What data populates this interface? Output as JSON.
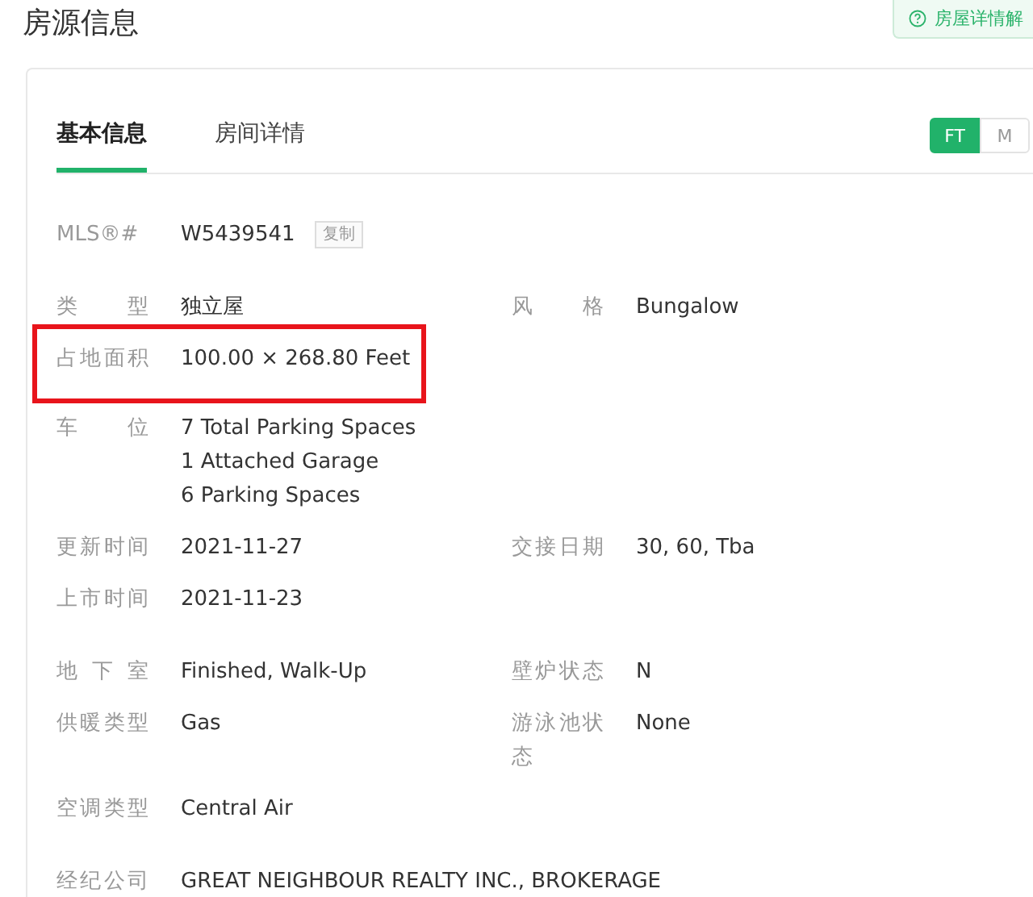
{
  "page_title": "房源信息",
  "help_button": {
    "label": "房屋详情解"
  },
  "tabs": [
    {
      "label": "基本信息",
      "selected": true
    },
    {
      "label": "房间详情",
      "selected": false
    }
  ],
  "unit_toggle": [
    {
      "label": "FT",
      "selected": true
    },
    {
      "label": "M",
      "selected": false
    }
  ],
  "sections": [
    {
      "rows": [
        {
          "fields": [
            {
              "kind": "id",
              "label": "MLS®#",
              "values": [
                "W5439541"
              ],
              "copy_button": "复制"
            }
          ]
        }
      ]
    },
    {
      "rows": [
        {
          "fields": [
            {
              "kind": "plain",
              "label": "类型",
              "values": [
                "独立屋"
              ]
            },
            {
              "kind": "plain",
              "label": "风格",
              "values": [
                "Bungalow"
              ]
            }
          ]
        },
        {
          "highlighted": true,
          "fields": [
            {
              "kind": "plain",
              "label": "占地面积",
              "values": [
                "100.00 × 268.80 Feet"
              ]
            }
          ]
        },
        {
          "fields": [
            {
              "kind": "plain",
              "label": "车位",
              "values": [
                "7 Total Parking Spaces",
                "1 Attached Garage",
                "6 Parking Spaces"
              ]
            }
          ]
        },
        {
          "fields": [
            {
              "kind": "plain",
              "label": "更新时间",
              "values": [
                "2021-11-27"
              ]
            },
            {
              "kind": "plain",
              "label": "交接日期",
              "values": [
                "30, 60, Tba"
              ]
            }
          ]
        },
        {
          "fields": [
            {
              "kind": "plain",
              "label": "上市时间",
              "values": [
                "2021-11-23"
              ]
            }
          ]
        }
      ]
    },
    {
      "rows": [
        {
          "fields": [
            {
              "kind": "plain",
              "label": "地下室",
              "values": [
                "Finished, Walk-Up"
              ]
            },
            {
              "kind": "plain",
              "label": "壁炉状态",
              "values": [
                "N"
              ]
            }
          ]
        },
        {
          "fields": [
            {
              "kind": "plain",
              "label": "供暖类型",
              "values": [
                "Gas"
              ]
            },
            {
              "kind": "plain",
              "label": "游泳池状态",
              "values": [
                "None"
              ]
            }
          ]
        },
        {
          "fields": [
            {
              "kind": "plain",
              "label": "空调类型",
              "values": [
                "Central Air"
              ]
            }
          ]
        }
      ]
    },
    {
      "rows": [
        {
          "fields": [
            {
              "kind": "plain",
              "label": "经纪公司",
              "values": [
                "GREAT NEIGHBOUR REALTY INC., BROKERAGE"
              ]
            }
          ]
        }
      ]
    }
  ]
}
